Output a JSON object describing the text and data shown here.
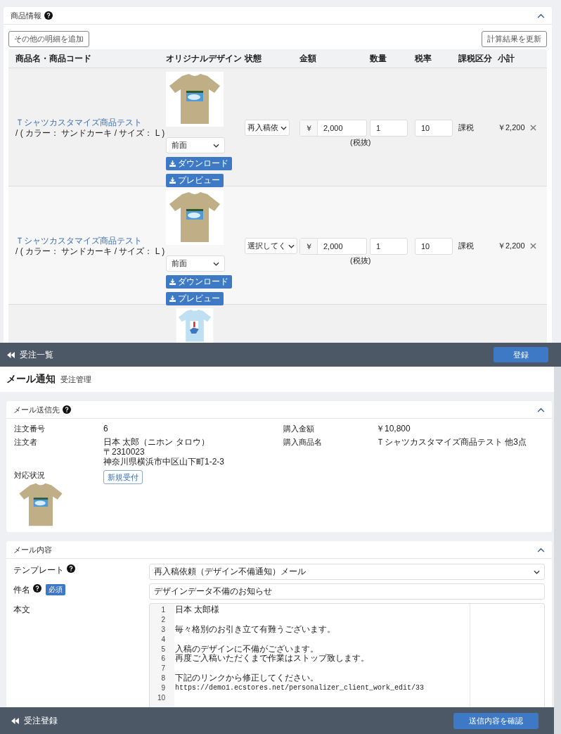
{
  "order_screen": {
    "section_title": "商品情報",
    "add_button": "その他の明細を追加",
    "update_button": "計算結果を更新",
    "columns": [
      "商品名・商品コード",
      "オリジナルデザイン",
      "状態",
      "金額",
      "数量",
      "税率",
      "課税区分",
      "小計"
    ],
    "rows": [
      {
        "name": "Ｔシャツカスタマイズ商品テスト",
        "options": "/ ( カラー： サンドカーキ / サイズ： L )",
        "color": "#bfae86",
        "kind": "photo",
        "side": "前面",
        "download": "ダウンロード",
        "preview": "プレビュー",
        "status": "再入稿依",
        "currency": "￥",
        "amount": "2,000",
        "tax_note": "(税抜)",
        "quantity": "1",
        "tax_rate": "10",
        "tax_class": "課税",
        "subtotal": "￥2,200"
      },
      {
        "name": "Ｔシャツカスタマイズ商品テスト",
        "options": "/ ( カラー： サンドカーキ / サイズ： L )",
        "color": "#bfae86",
        "kind": "photo",
        "side": "前面",
        "download": "ダウンロード",
        "preview": "プレビュー",
        "status": "選択してく",
        "currency": "￥",
        "amount": "2,000",
        "tax_note": "(税抜)",
        "quantity": "1",
        "tax_rate": "10",
        "tax_class": "課税",
        "subtotal": "￥2,200"
      },
      {
        "color": "#bfe0f3",
        "kind": "number"
      }
    ],
    "back_link": "受注一覧",
    "register_button": "登録"
  },
  "mail_screen": {
    "title": "メール通知",
    "breadcrumb": "受注管理",
    "recipient": {
      "title": "メール送信先",
      "fields": [
        {
          "label": "注文番号",
          "values": [
            "6"
          ]
        },
        {
          "label": "購入金額",
          "values": [
            "￥10,800"
          ]
        },
        {
          "label": "注文者",
          "values": [
            "日本 太郎（ニホン タロウ）",
            "〒2310023",
            "神奈川県横浜市中区山下町1-2-3"
          ]
        },
        {
          "label": "購入商品名",
          "values": [
            "Ｔシャツカスタマイズ商品テスト 他3点"
          ]
        }
      ],
      "status_label": "対応状況",
      "status": "新規受付"
    },
    "content": {
      "title": "メール内容",
      "template_label": "テンプレート",
      "template": "再入稿依頼（デザイン不備通知）メール",
      "subject_label": "件名",
      "required": "必須",
      "subject": "デザインデータ不備のお知らせ",
      "body_label": "本文",
      "lines": [
        {
          "number": "1",
          "text": "日本 太郎様"
        },
        {
          "number": "2"
        },
        {
          "number": "3",
          "text": "毎々格別のお引き立て有難うございます。"
        },
        {
          "number": "4"
        },
        {
          "number": "5",
          "text": "入稿のデザインに不備がございます。"
        },
        {
          "number": "6",
          "text": "再度ご入稿いただくまで作業はストップ致します。"
        },
        {
          "number": "7"
        },
        {
          "number": "8",
          "text": "下記のリンクから修正してください。"
        },
        {
          "number": "9",
          "text": "https://demo1.ecstores.net/personalizer_client_work_edit/33",
          "kind": "url"
        },
        {
          "number": "10"
        }
      ]
    },
    "back_link": "受注登録",
    "confirm_button": "送信内容を確認"
  }
}
